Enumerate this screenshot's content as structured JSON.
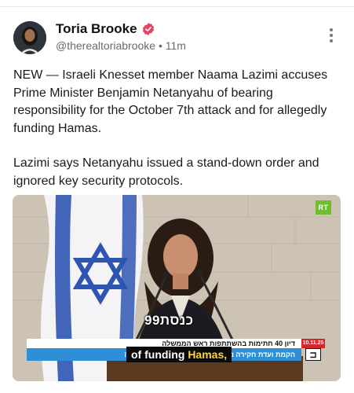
{
  "post": {
    "author_name": "Toria Brooke",
    "handle": "@therealtoriabrooke",
    "separator": "•",
    "time": "11m",
    "verified_icon": "verified-badge-icon",
    "more_icon": "more-vertical-icon",
    "paragraphs": [
      "NEW — Israeli Knesset member Naama Lazimi accuses Prime Minister Benjamin Netanyahu of bearing responsibility for the October 7th attack and for allegedly funding Hamas.",
      "Lazimi says Netanyahu issued a stand-down order and ignored key security protocols."
    ]
  },
  "video": {
    "broadcaster_logo": "RT",
    "channel_logo": "כנסת99",
    "ticker_headline": "דיון 40 חתימות בהשתתפות ראש הממשלה",
    "ticker_date": "10.11.25",
    "ticker_subline": "הקמת ועדת חקירה ממלכתית ח\"כ נעמה לזימי, העבודה",
    "caption_prefix": "of funding",
    "caption_highlight": "Hamas,"
  },
  "colors": {
    "accent_verified": "#e8415f",
    "ticker_blue": "#2e8fd6",
    "ticker_red": "#d4262b",
    "caption_highlight": "#ffd52e"
  }
}
